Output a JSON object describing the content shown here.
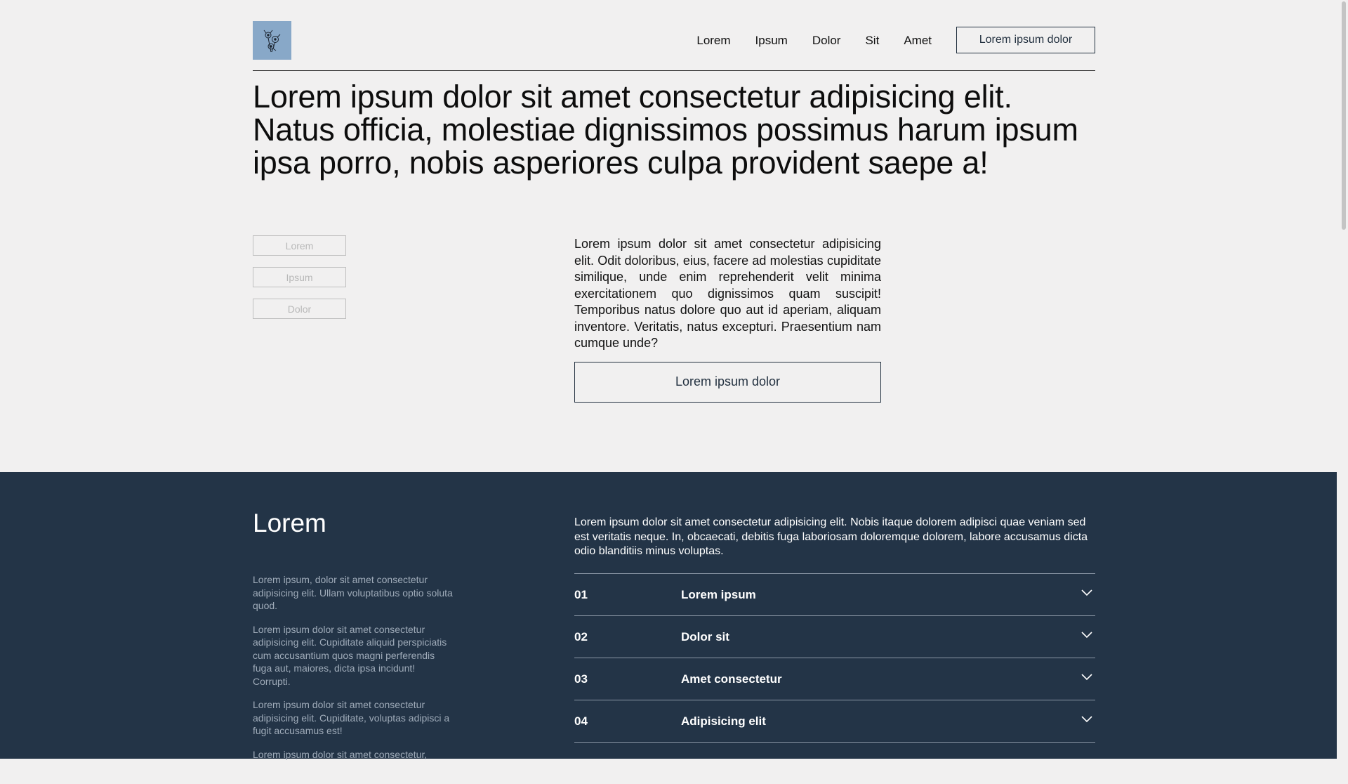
{
  "header": {
    "logo_alt": "logo",
    "nav": [
      "Lorem",
      "Ipsum",
      "Dolor",
      "Sit",
      "Amet"
    ],
    "cta": "Lorem ipsum dolor"
  },
  "hero": {
    "title": "Lorem ipsum dolor sit amet consectetur adipisicing elit. Natus officia, molestiae dignissimos possimus harum ipsum ipsa porro, nobis asperiores culpa provident saepe a!",
    "tabs": [
      "Lorem",
      "Ipsum",
      "Dolor"
    ],
    "paragraph": "Lorem ipsum dolor sit amet consectetur adipisicing elit. Odit doloribus, eius, facere ad molestias cupiditate similique, unde enim reprehenderit velit minima exercitationem quo dignissimos quam suscipit! Temporibus natus dolore quo aut id aperiam, aliquam inventore. Veritatis, natus excepturi. Praesentium nam cumque unde?",
    "cta": "Lorem ipsum dolor"
  },
  "dark_section": {
    "title": "Lorem",
    "left_paragraphs": [
      "Lorem ipsum, dolor sit amet consectetur adipisicing elit. Ullam voluptatibus optio soluta quod.",
      "Lorem ipsum dolor sit amet consectetur adipisicing elit. Cupiditate aliquid perspiciatis cum accusantium quos magni perferendis fuga aut, maiores, dicta ipsa incidunt! Corrupti.",
      "Lorem ipsum dolor sit amet consectetur adipisicing elit. Cupiditate, voluptas adipisci a fugit accusamus est!",
      "Lorem ipsum dolor sit amet consectetur,"
    ],
    "lead": "Lorem ipsum dolor sit amet consectetur adipisicing elit. Nobis itaque dolorem adipisci quae veniam sed est veritatis neque. In, obcaecati, debitis fuga laboriosam doloremque dolorem, labore accusamus dicta odio blanditiis minus voluptas.",
    "accordion": [
      {
        "num": "01",
        "label": "Lorem ipsum"
      },
      {
        "num": "02",
        "label": "Dolor sit"
      },
      {
        "num": "03",
        "label": "Amet consectetur"
      },
      {
        "num": "04",
        "label": "Adipisicing elit"
      }
    ]
  },
  "colors": {
    "background": "#f1f0f0",
    "dark": "#233447",
    "logo": "#88a8c8"
  },
  "icons": {
    "logo": "flower-icon",
    "chevron": "chevron-down-icon"
  }
}
